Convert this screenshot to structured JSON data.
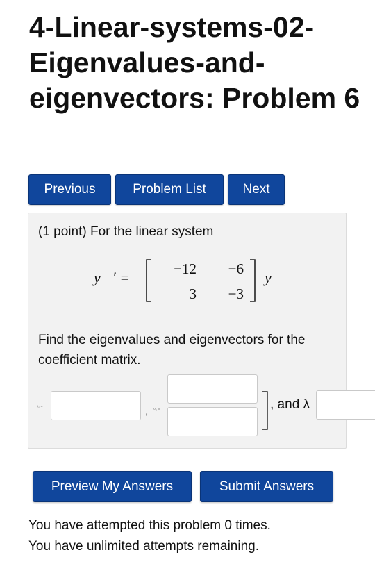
{
  "page": {
    "title": "4-Linear-systems-02-Eigenvalues-and-eigenvectors: Problem 6"
  },
  "nav": {
    "previous": "Previous",
    "problem_list": "Problem List",
    "next": "Next"
  },
  "problem": {
    "intro": "(1 point) For the linear system",
    "lhs": "y⃗′ =",
    "matrix": [
      [
        "−12",
        "−6"
      ],
      [
        "3",
        "−3"
      ]
    ],
    "rhs": "y⃗",
    "question": "Find the eigenvalues and eigenvectors for the coefficient matrix.",
    "small_label_1": "λ₁ =",
    "small_label_2": "v₁ =",
    "and_text": ", and λ"
  },
  "actions": {
    "preview": "Preview My Answers",
    "submit": "Submit Answers"
  },
  "footer": {
    "attempts": "You have attempted this problem 0 times.",
    "remaining": "You have unlimited attempts remaining."
  }
}
